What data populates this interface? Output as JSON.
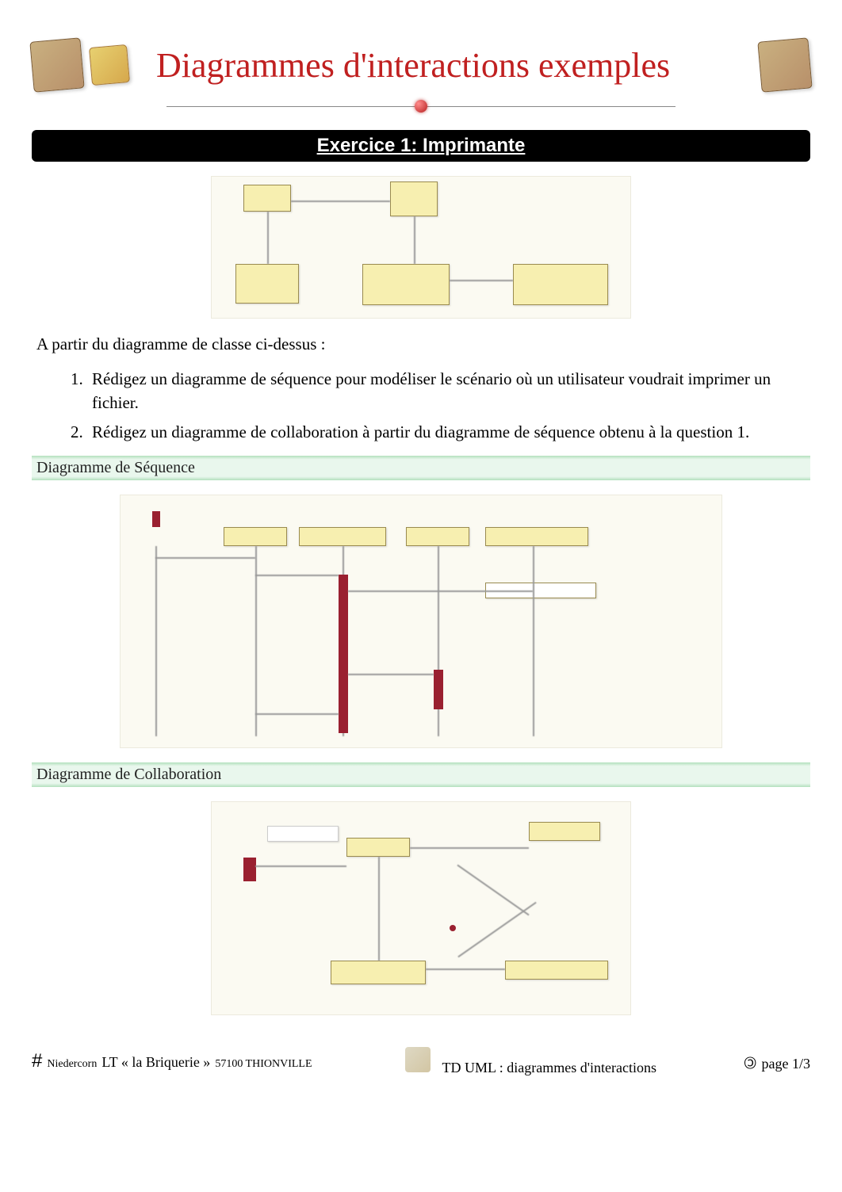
{
  "title": "Diagrammes d'interactions exemples",
  "exercise_bar": "Exercice 1: Imprimante",
  "intro": "A partir du diagramme de classe ci-dessus :",
  "questions": {
    "q1": "Rédigez un diagramme de séquence pour modéliser le scénario où un utilisateur voudrait imprimer un fichier.",
    "q2": "Rédigez un diagramme de collaboration à partir du diagramme de séquence obtenu à la question 1."
  },
  "section_sequence": "Diagramme de Séquence",
  "section_collab": "Diagramme de Collaboration",
  "footer": {
    "hash": "#",
    "author_small": "Niedercorn",
    "school": "LT « la Briquerie »",
    "city_small": "57100 THIONVILLE",
    "doc_title": "TD UML : diagrammes d'interactions",
    "copyleft": "🄯",
    "page": "page 1/3"
  }
}
